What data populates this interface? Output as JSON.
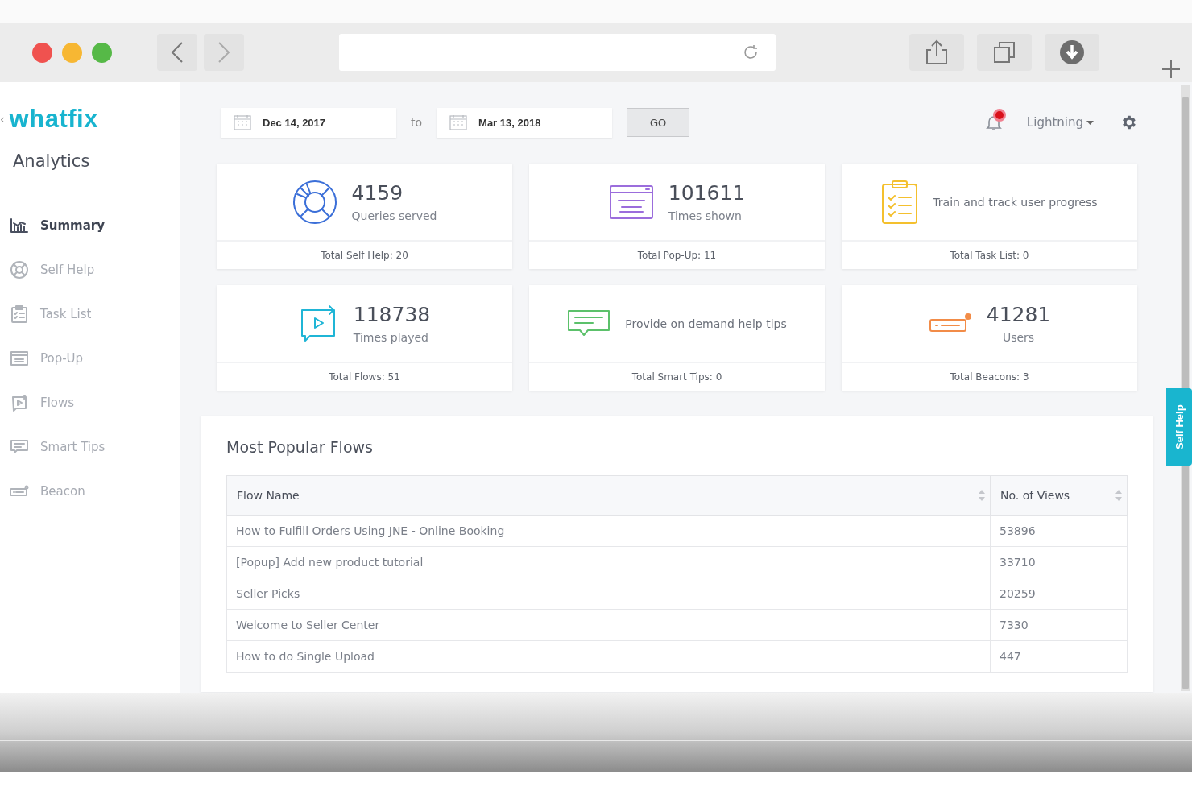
{
  "sidebar": {
    "logo": "whatfix",
    "collapse": "‹",
    "title": "Analytics",
    "items": [
      {
        "label": "Summary",
        "selected": true
      },
      {
        "label": "Self Help",
        "selected": false
      },
      {
        "label": "Task List",
        "selected": false
      },
      {
        "label": "Pop-Up",
        "selected": false
      },
      {
        "label": "Flows",
        "selected": false
      },
      {
        "label": "Smart Tips",
        "selected": false
      },
      {
        "label": "Beacon",
        "selected": false
      }
    ]
  },
  "filters": {
    "from": "Dec 14, 2017",
    "to_label": "to",
    "to": "Mar 13, 2018",
    "go": "GO"
  },
  "header": {
    "notification": true,
    "account": "Lightning"
  },
  "cards": [
    {
      "kind": "metric",
      "value": "4159",
      "caption": "Queries served",
      "footer": "Total Self Help: 20"
    },
    {
      "kind": "metric",
      "value": "101611",
      "caption": "Times shown",
      "footer": "Total Pop-Up: 11"
    },
    {
      "kind": "tip",
      "caption": "Train and track user progress",
      "footer": "Total Task List: 0"
    },
    {
      "kind": "metric",
      "value": "118738",
      "caption": "Times played",
      "footer": "Total Flows: 51"
    },
    {
      "kind": "tip",
      "caption": "Provide on demand help tips",
      "footer": "Total Smart Tips: 0"
    },
    {
      "kind": "metric",
      "value": "41281",
      "caption": "Users",
      "footer": "Total Beacons: 3"
    }
  ],
  "table": {
    "title": "Most Popular Flows",
    "columns": [
      "Flow Name",
      "No. of Views"
    ],
    "rows": [
      [
        "How to Fulfill Orders Using JNE - Online Booking",
        "53896"
      ],
      [
        "[Popup] Add new product tutorial",
        "33710"
      ],
      [
        "Seller Picks",
        "20259"
      ],
      [
        "Welcome to Seller Center",
        "7330"
      ],
      [
        "How to do Single Upload",
        "447"
      ]
    ]
  },
  "self_help_tab": "Self Help"
}
